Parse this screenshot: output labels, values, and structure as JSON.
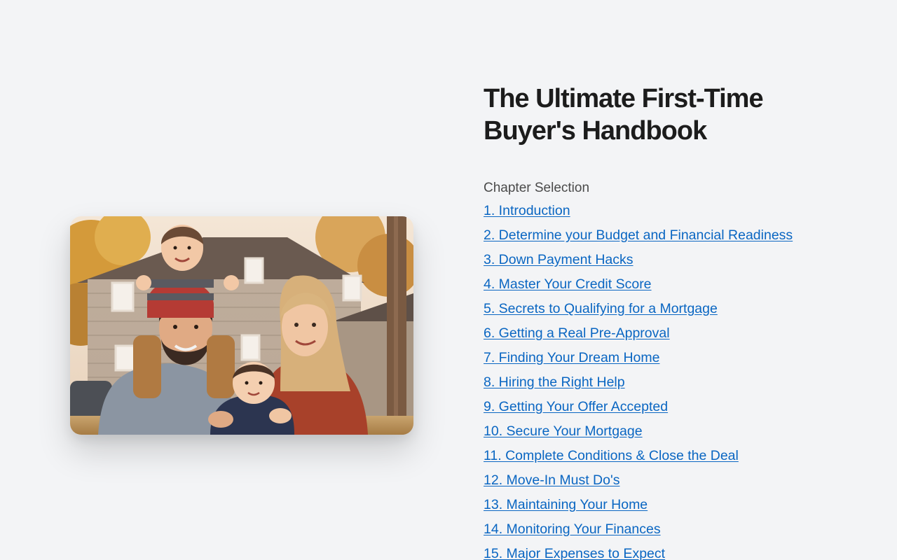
{
  "hero": {
    "image_alt": "Family of four smiling in front of a house"
  },
  "title": "The Ultimate First-Time Buyer's Handbook",
  "chapter_heading": "Chapter Selection",
  "chapters": [
    "1. Introduction",
    "2. Determine your Budget and Financial Readiness",
    "3. Down Payment Hacks",
    "4. Master Your Credit Score",
    "5. Secrets to Qualifying for a Mortgage",
    "6. Getting a Real Pre-Approval",
    "7. Finding Your Dream Home",
    "8. Hiring the Right Help",
    "9. Getting Your Offer Accepted",
    "10. Secure Your Mortgage",
    "11. Complete Conditions & Close the Deal",
    "12. Move-In Must Do's",
    "13. Maintaining Your Home",
    "14. Monitoring Your Finances",
    "15. Major Expenses to Expect"
  ],
  "colors": {
    "background": "#f3f4f6",
    "link": "#0a66c2",
    "title": "#1c1c1c"
  }
}
